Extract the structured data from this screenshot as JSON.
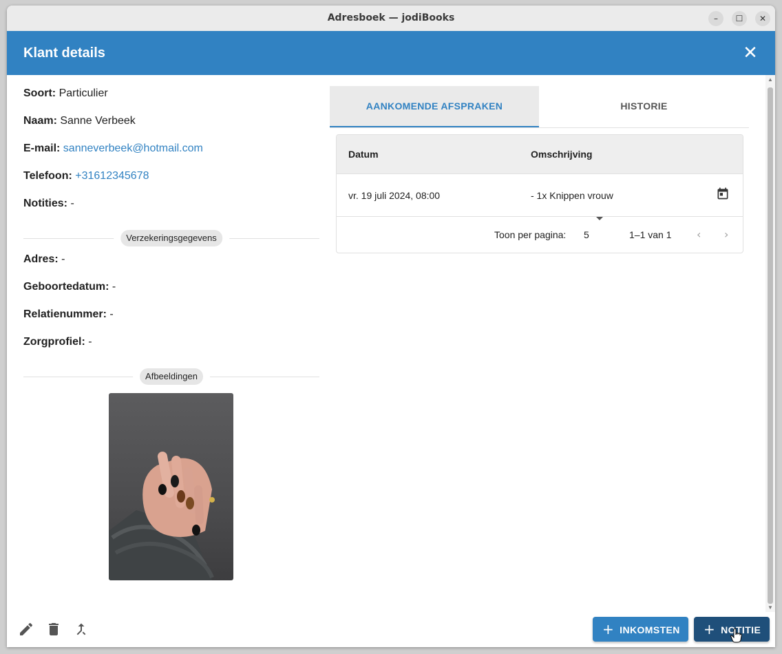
{
  "window": {
    "title": "Adresboek — jodiBooks"
  },
  "dialog": {
    "title": "Klant details"
  },
  "details": {
    "soort_label": "Soort:",
    "soort_value": "Particulier",
    "naam_label": "Naam:",
    "naam_value": "Sanne Verbeek",
    "email_label": "E-mail:",
    "email_value": "sanneverbeek@hotmail.com",
    "telefoon_label": "Telefoon:",
    "telefoon_value": "+31612345678",
    "notities_label": "Notities:",
    "notities_value": "-"
  },
  "insurance": {
    "section_label": "Verzekeringsgegevens",
    "adres_label": "Adres:",
    "adres_value": "-",
    "geboortedatum_label": "Geboortedatum:",
    "geboortedatum_value": "-",
    "relatienummer_label": "Relatienummer:",
    "relatienummer_value": "-",
    "zorgprofiel_label": "Zorgprofiel:",
    "zorgprofiel_value": "-"
  },
  "images": {
    "section_label": "Afbeeldingen"
  },
  "tabs": [
    {
      "label": "AANKOMENDE AFSPRAKEN",
      "active": true
    },
    {
      "label": "HISTORIE",
      "active": false
    }
  ],
  "table": {
    "headers": [
      "Datum",
      "Omschrijving"
    ],
    "rows": [
      {
        "datum": "vr. 19 juli 2024, 08:00",
        "omschrijving": "- 1x Knippen vrouw",
        "icon": "calendar-icon"
      }
    ],
    "rows_per_page_label": "Toon per pagina:",
    "rows_per_page_value": "5",
    "range_label": "1–1 van 1"
  },
  "footer": {
    "icons": [
      "edit-icon",
      "delete-icon",
      "merge-icon"
    ],
    "inkomsten_label": "INKOMSTEN",
    "notitie_label": "NOTITIE"
  },
  "colors": {
    "accent": "#3182c2",
    "dark_button": "#1f4f7a",
    "titlebar": "#ebebeb"
  }
}
